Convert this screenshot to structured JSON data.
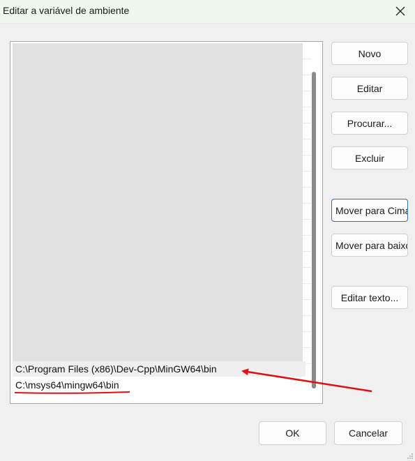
{
  "window": {
    "title": "Editar a variável de ambiente"
  },
  "list": {
    "items": [
      "C:\\Program Files (x86)\\Dev-Cpp\\MinGW64\\bin",
      "C:\\msys64\\mingw64\\bin"
    ]
  },
  "buttons": {
    "novo": "Novo",
    "editar": "Editar",
    "procurar": "Procurar...",
    "excluir": "Excluir",
    "mover_cima": "Mover para Cima",
    "mover_baixo": "Mover para baixo",
    "editar_texto": "Editar texto...",
    "ok": "OK",
    "cancelar": "Cancelar"
  },
  "colors": {
    "annotation": "#e01010",
    "focus_border": "#2f6fc0"
  },
  "icons": [
    "close-icon",
    "resize-grip-icon"
  ]
}
